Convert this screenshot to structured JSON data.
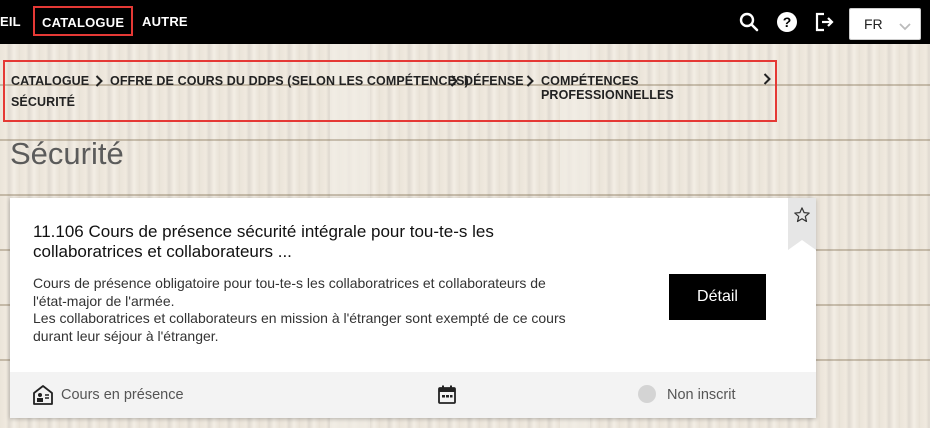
{
  "nav": {
    "items": [
      {
        "label": "EIL",
        "active": false
      },
      {
        "label": "CATALOGUE",
        "active": true
      },
      {
        "label": "AUTRE",
        "active": false
      }
    ],
    "icons": [
      "search-icon",
      "help-icon",
      "logout-icon"
    ],
    "language": {
      "value": "FR"
    }
  },
  "breadcrumb": {
    "items": [
      "CATALOGUE",
      "OFFRE DE COURS DU DDPS (SELON LES COMPÉTENCES)",
      "DÉFENSE",
      "COMPÉTENCES PROFESSIONNELLES",
      "SÉCURITÉ"
    ]
  },
  "page": {
    "title": "Sécurité"
  },
  "course": {
    "title_line1": "11.106 Cours de présence sécurité intégrale pour tou-te-s les",
    "title_line2": "collaboratrices et collaborateurs ...",
    "desc_lines": [
      "Cours de présence obligatoire pour tou-te-s les collaboratrices et collaborateurs de",
      "l'état-major de l'armée.",
      "Les collaboratrices et collaborateurs en mission à l'étranger sont exempté de ce cours",
      "durant leur séjour à l'étranger."
    ],
    "detail_label": "Détail",
    "type_label": "Cours en présence",
    "status_label": "Non inscrit"
  },
  "colors": {
    "topbar": "#000000",
    "highlight": "#e53935",
    "button": "#000000"
  }
}
